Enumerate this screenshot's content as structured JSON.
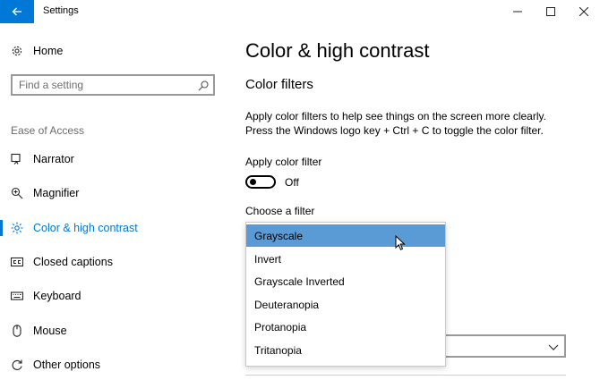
{
  "window": {
    "title": "Settings",
    "controls": [
      "minimize-icon",
      "maximize-icon",
      "close-icon"
    ]
  },
  "sidebar": {
    "home_label": "Home",
    "search_placeholder": "Find a setting",
    "section_label": "Ease of Access",
    "items": [
      {
        "label": "Narrator",
        "icon": "narrator-icon",
        "active": false
      },
      {
        "label": "Magnifier",
        "icon": "magnifier-icon",
        "active": false
      },
      {
        "label": "Color & high contrast",
        "icon": "brightness-icon",
        "active": true
      },
      {
        "label": "Closed captions",
        "icon": "closed-captions-icon",
        "active": false
      },
      {
        "label": "Keyboard",
        "icon": "keyboard-icon",
        "active": false
      },
      {
        "label": "Mouse",
        "icon": "mouse-icon",
        "active": false
      },
      {
        "label": "Other options",
        "icon": "refresh-icon",
        "active": false
      }
    ]
  },
  "main": {
    "page_title": "Color & high contrast",
    "subheading": "Color filters",
    "description_line1": "Apply color filters to help see things on the screen more clearly.",
    "description_line2": "Press the Windows logo key + Ctrl + C to toggle the color filter.",
    "toggle_label": "Apply color filter",
    "toggle_state": "Off",
    "filter_label": "Choose a filter",
    "filter_options": [
      {
        "label": "Grayscale",
        "selected": true
      },
      {
        "label": "Invert",
        "selected": false
      },
      {
        "label": "Grayscale Inverted",
        "selected": false
      },
      {
        "label": "Deuteranopia",
        "selected": false
      },
      {
        "label": "Protanopia",
        "selected": false
      },
      {
        "label": "Tritanopia",
        "selected": false
      }
    ]
  },
  "colors": {
    "accent": "#0078d7",
    "dropdown_highlight": "#5b9bd5"
  }
}
